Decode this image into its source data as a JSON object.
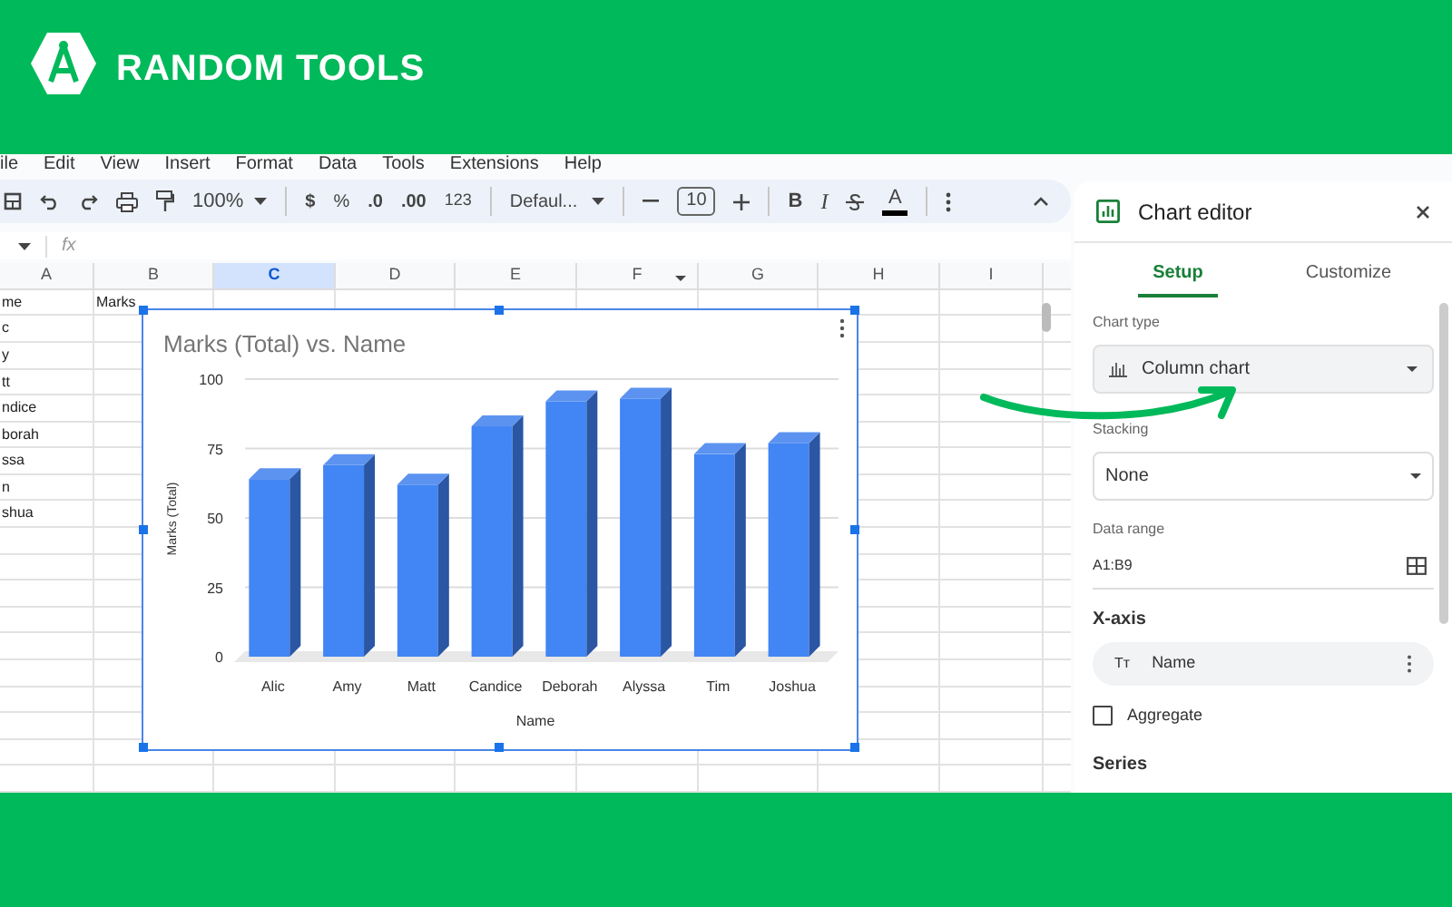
{
  "brand": {
    "name": "RANDOM TOOLS"
  },
  "menu": [
    "ile",
    "Edit",
    "View",
    "Insert",
    "Format",
    "Data",
    "Tools",
    "Extensions",
    "Help"
  ],
  "toolbar": {
    "zoom": "100%",
    "currency": "$",
    "percent": "%",
    "decrease_decimals": ".0",
    "increase_decimals": ".00",
    "number_format": "123",
    "font": "Defaul...",
    "font_size": "10",
    "bold": "B",
    "italic": "I",
    "text_color": "A"
  },
  "formula_bar": {
    "fx": "fx"
  },
  "sheet": {
    "columns": [
      {
        "label": "A",
        "selected": false
      },
      {
        "label": "B",
        "selected": false
      },
      {
        "label": "C",
        "selected": true
      },
      {
        "label": "D",
        "selected": false
      },
      {
        "label": "E",
        "selected": false
      },
      {
        "label": "F",
        "selected": false
      },
      {
        "label": "G",
        "selected": false
      },
      {
        "label": "H",
        "selected": false
      },
      {
        "label": "I",
        "selected": false
      }
    ],
    "rows": [
      {
        "a": "me",
        "b": "Marks"
      },
      {
        "a": "c"
      },
      {
        "a": "y"
      },
      {
        "a": "tt"
      },
      {
        "a": "ndice"
      },
      {
        "a": "borah"
      },
      {
        "a": "ssa"
      },
      {
        "a": "n"
      },
      {
        "a": "shua"
      }
    ]
  },
  "chart": {
    "chart_data": {
      "type": "bar",
      "title": "Marks (Total) vs. Name",
      "xlabel": "Name",
      "ylabel": "Marks (Total)",
      "categories": [
        "Alic",
        "Amy",
        "Matt",
        "Candice",
        "Deborah",
        "Alyssa",
        "Tim",
        "Joshua"
      ],
      "series": [
        {
          "color": "#4285f4",
          "values": [
            64,
            69,
            62,
            83,
            92,
            93,
            73,
            77
          ]
        }
      ],
      "grid": true,
      "ylim": [
        0,
        100
      ],
      "yticks": [
        0,
        25,
        50,
        75,
        100
      ]
    }
  },
  "editor": {
    "title": "Chart editor",
    "tabs": [
      {
        "label": "Setup",
        "selected": true
      },
      {
        "label": "Customize",
        "selected": false
      }
    ],
    "chart_type": {
      "label": "Chart type",
      "value": "Column chart"
    },
    "stacking": {
      "label": "Stacking",
      "value": "None"
    },
    "data_range": {
      "label": "Data range",
      "value": "A1:B9"
    },
    "x_axis": {
      "heading": "X-axis",
      "type_icon": "Tт",
      "value": "Name"
    },
    "aggregate": {
      "label": "Aggregate",
      "checked": false
    },
    "series_heading": "Series"
  }
}
